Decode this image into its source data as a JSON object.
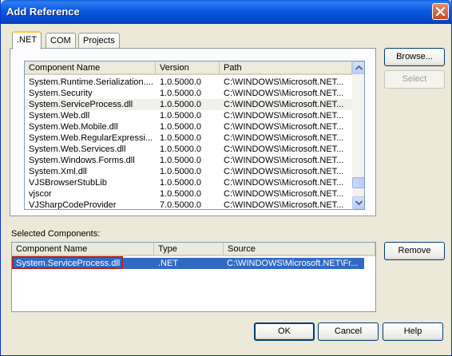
{
  "window": {
    "title": "Add Reference"
  },
  "tabs": [
    {
      "label": ".NET",
      "active": true
    },
    {
      "label": "COM",
      "active": false
    },
    {
      "label": "Projects",
      "active": false
    }
  ],
  "references": {
    "columns": [
      "Component Name",
      "Version",
      "Path"
    ],
    "rows": [
      [
        "System.Runtime.Serialization....",
        "1.0.5000.0",
        "C:\\WINDOWS\\Microsoft.NET..."
      ],
      [
        "System.Security",
        "1.0.5000.0",
        "C:\\WINDOWS\\Microsoft.NET..."
      ],
      [
        "System.ServiceProcess.dll",
        "1.0.5000.0",
        "C:\\WINDOWS\\Microsoft.NET..."
      ],
      [
        "System.Web.dll",
        "1.0.5000.0",
        "C:\\WINDOWS\\Microsoft.NET..."
      ],
      [
        "System.Web.Mobile.dll",
        "1.0.5000.0",
        "C:\\WINDOWS\\Microsoft.NET..."
      ],
      [
        "System.Web.RegularExpressi...",
        "1.0.5000.0",
        "C:\\WINDOWS\\Microsoft.NET..."
      ],
      [
        "System.Web.Services.dll",
        "1.0.5000.0",
        "C:\\WINDOWS\\Microsoft.NET..."
      ],
      [
        "System.Windows.Forms.dll",
        "1.0.5000.0",
        "C:\\WINDOWS\\Microsoft.NET..."
      ],
      [
        "System.Xml.dll",
        "1.0.5000.0",
        "C:\\WINDOWS\\Microsoft.NET..."
      ],
      [
        "VJSBrowserStubLib",
        "1.0.5000.0",
        "C:\\WINDOWS\\Microsoft.NET..."
      ],
      [
        "vjscor",
        "1.0.5000.0",
        "C:\\WINDOWS\\Microsoft.NET..."
      ],
      [
        "VJSharpCodeProvider",
        "7.0.5000.0",
        "C:\\WINDOWS\\Microsoft.NET..."
      ]
    ],
    "highlighted_row": 2
  },
  "buttons": {
    "browse": "Browse...",
    "select": "Select",
    "remove": "Remove",
    "ok": "OK",
    "cancel": "Cancel",
    "help": "Help"
  },
  "selected": {
    "label": "Selected Components:",
    "columns": [
      "Component Name",
      "Type",
      "Source"
    ],
    "rows": [
      [
        "System.ServiceProcess.dll",
        ".NET",
        "C:\\WINDOWS\\Microsoft.NET\\Fr..."
      ]
    ]
  },
  "colors": {
    "titlebar": "#0859e0",
    "selection": "#316ac5",
    "annotation": "#b22222"
  }
}
